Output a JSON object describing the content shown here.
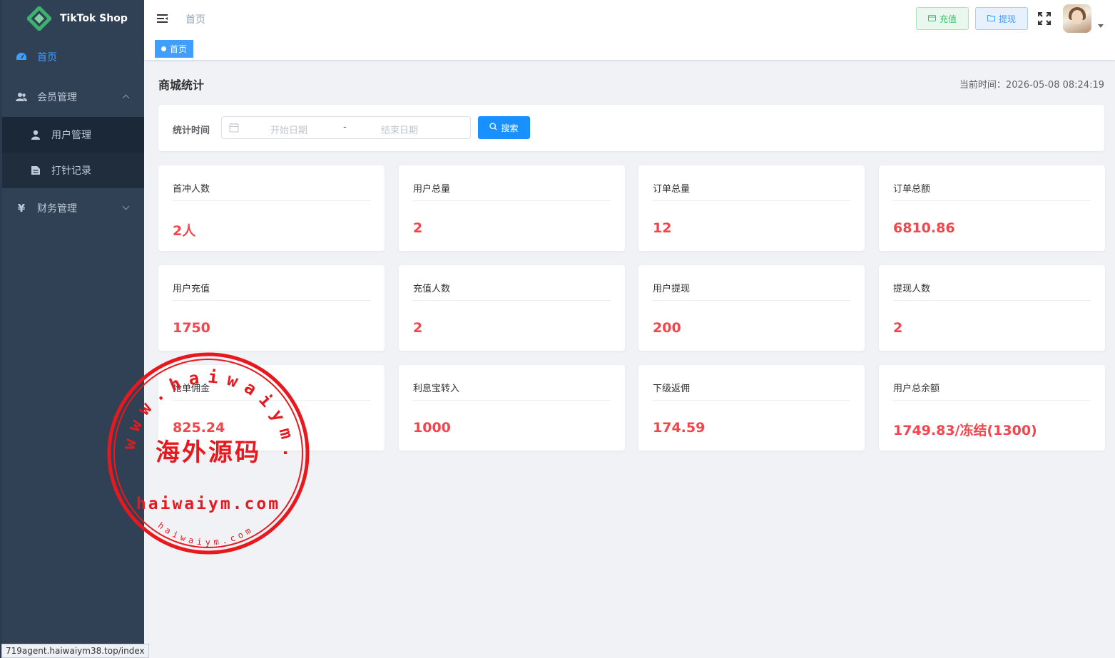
{
  "brand": {
    "title": "TikTok Shop",
    "logo_color": "#3cb26e"
  },
  "sidebar": {
    "items": [
      {
        "label": "首页",
        "icon": "dashboard-icon",
        "active": true
      },
      {
        "label": "会员管理",
        "icon": "users-icon",
        "expanded": true,
        "children": [
          {
            "label": "用户管理",
            "icon": "user-icon"
          },
          {
            "label": "打针记录",
            "icon": "document-icon"
          }
        ]
      },
      {
        "label": "财务管理",
        "icon": "yen-icon",
        "expanded": false
      }
    ]
  },
  "status_url": "719agent.haiwaiym38.top/index",
  "header": {
    "breadcrumb": "首页",
    "recharge_label": "充值",
    "withdraw_label": "提现"
  },
  "tags": [
    {
      "label": "首页"
    }
  ],
  "page": {
    "title": "商城统计",
    "current_time_label": "当前时间：",
    "current_time": "2026-05-08 08:24:19"
  },
  "search": {
    "label": "统计时间",
    "start_placeholder": "开始日期",
    "separator": "-",
    "end_placeholder": "结束日期",
    "button": "搜索"
  },
  "stats": [
    {
      "title": "首冲人数",
      "value": "2人"
    },
    {
      "title": "用户总量",
      "value": "2"
    },
    {
      "title": "订单总量",
      "value": "12"
    },
    {
      "title": "订单总额",
      "value": "6810.86"
    },
    {
      "title": "用户充值",
      "value": "1750"
    },
    {
      "title": "充值人数",
      "value": "2"
    },
    {
      "title": "用户提现",
      "value": "200"
    },
    {
      "title": "提现人数",
      "value": "2"
    },
    {
      "title": "抢单佣金",
      "value": "825.24"
    },
    {
      "title": "利息宝转入",
      "value": "1000"
    },
    {
      "title": "下级返佣",
      "value": "174.59"
    },
    {
      "title": "用户总余额",
      "value": "1749.83/冻结(1300)"
    }
  ],
  "watermark": {
    "ring_text": "www.haiwaiym.com",
    "center_text": "海外源码",
    "bottom_text": "haiwaiym.com",
    "small_text": "haiwaiym.com",
    "color": "#e8191e"
  },
  "colors": {
    "accent": "#409eff",
    "value_red": "#f4444c",
    "sidebar_bg": "#304156"
  }
}
